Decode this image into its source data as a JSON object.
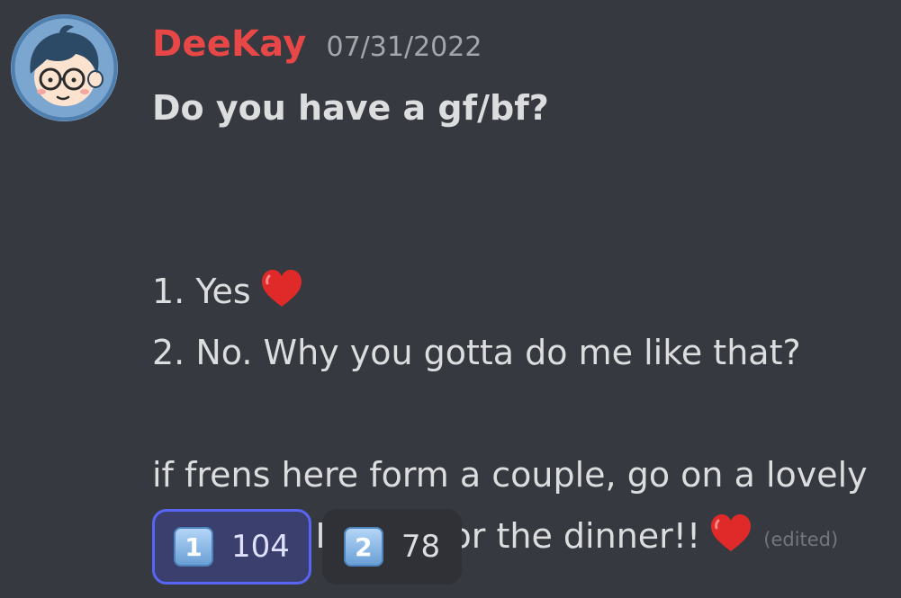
{
  "message": {
    "author": "DeeKay",
    "timestamp": "07/31/2022",
    "title": "Do you have a gf/bf?",
    "option_1": "1. Yes",
    "option_2": "2. No. Why you gotta do me like that?",
    "paragraph_line_1": "if frens here form a couple, go on a lovely",
    "paragraph_line_2": "date and I'll pay for the dinner!!",
    "edited_label": "(edited)",
    "emoji": "heart-emoji"
  },
  "reactions": [
    {
      "emoji": "1",
      "count": "104",
      "active": true
    },
    {
      "emoji": "2",
      "count": "78",
      "active": false
    }
  ],
  "colors": {
    "background": "#36393f",
    "username": "#e84747",
    "text": "#dcddde",
    "timestamp": "#a3a6aa",
    "reaction_active_border": "#5865f2",
    "reaction_background": "#2f3136"
  }
}
